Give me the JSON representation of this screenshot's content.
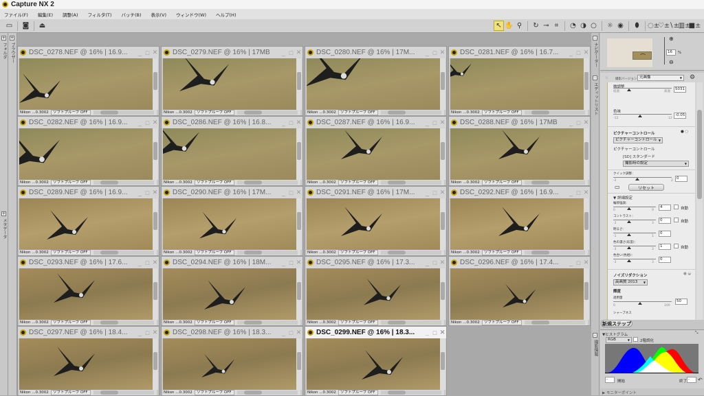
{
  "app": {
    "title": "Capture NX 2"
  },
  "menu": [
    "ファイル(F)",
    "編集(E)",
    "調整(A)",
    "フィルタ(T)",
    "バッチ(B)",
    "表示(V)",
    "ウィンドウ(W)",
    "ヘルプ(H)"
  ],
  "left_tabs": {
    "folder": "フォルダ",
    "browser": "ブラウザー",
    "metadata": "メタデータ"
  },
  "tiles": [
    {
      "title": "DSC_0278.NEF @ 16% | 16.9..."
    },
    {
      "title": "DSC_0279.NEF @ 16% | 17MB"
    },
    {
      "title": "DSC_0280.NEF @ 16% | 17M..."
    },
    {
      "title": "DSC_0281.NEF @ 16% | 16.7..."
    },
    {
      "title": "DSC_0282.NEF @ 16% | 16.9..."
    },
    {
      "title": "DSC_0286.NEF @ 16% | 16.8..."
    },
    {
      "title": "DSC_0287.NEF @ 16% | 16.9..."
    },
    {
      "title": "DSC_0288.NEF @ 16% | 17MB"
    },
    {
      "title": "DSC_0289.NEF @ 16% | 16.9..."
    },
    {
      "title": "DSC_0290.NEF @ 16% | 17M..."
    },
    {
      "title": "DSC_0291.NEF @ 16% | 17M..."
    },
    {
      "title": "DSC_0292.NEF @ 16% | 16.9..."
    },
    {
      "title": "DSC_0293.NEF @ 16% | 17.6..."
    },
    {
      "title": "DSC_0294.NEF @ 16% | 18M..."
    },
    {
      "title": "DSC_0295.NEF @ 16% | 17.3..."
    },
    {
      "title": "DSC_0296.NEF @ 16% | 17.4..."
    },
    {
      "title": "DSC_0297.NEF @ 16% | 18.4..."
    },
    {
      "title": "DSC_0298.NEF @ 16% | 18.3..."
    },
    {
      "title": "DSC_0299.NEF @ 16% | 18.3...",
      "active": true
    }
  ],
  "tile_status": {
    "camera": "Nikon ...0.3002",
    "softproof": "ソフトプルーフ OFF"
  },
  "right": {
    "tabs": {
      "navigator": "ナビゲーター",
      "editlist": "エディットリスト",
      "info": "撮影情報"
    },
    "navigator": {
      "zoom": "16",
      "unit": "%"
    },
    "version_label": "撮影バージョン",
    "version": "元画像",
    "fine": {
      "label": "微調整",
      "low": "低温",
      "high": "高温",
      "value": "5031"
    },
    "tint": {
      "label": "色味",
      "min": "-12",
      "max": "12",
      "value": "-0.05"
    },
    "pc": {
      "header": "ピクチャーコントロール",
      "dropdown": "ピクチャーコントロール",
      "label": "ピクチャーコントロール",
      "preset": "[SD] スタンダード",
      "setting": "撮影時の設定"
    },
    "quick": {
      "label": "クイック調整：",
      "min": "-2",
      "max": "2",
      "value": "0",
      "reset": "リセット"
    },
    "detail": "▼ 詳細設定",
    "auto": "自動",
    "sliders": [
      {
        "label": "輪郭強調：",
        "min": "0",
        "max": "9",
        "value": "4",
        "auto": true
      },
      {
        "label": "コントラスト：",
        "min": "-3",
        "max": "3",
        "value": "0",
        "auto": true
      },
      {
        "label": "明るさ：",
        "min": "-1",
        "max": "1",
        "value": "0",
        "auto": false
      },
      {
        "label": "色の濃さ(彩度)：",
        "min": "-3",
        "max": "3",
        "value": "1",
        "auto": true
      },
      {
        "label": "色合い(色相)：",
        "min": "-3",
        "max": "3",
        "value": "0",
        "auto": false
      }
    ],
    "nr": {
      "header": "ノイズリダクション",
      "mode": "高画質 2013",
      "lum": "輝度",
      "amount": "適用量",
      "min": "0",
      "max": "100",
      "value": "50",
      "sharp": "シャープネス"
    },
    "new_step": "新規ステップ",
    "histogram": {
      "header": "▼ヒストグラム",
      "channel": "RGB",
      "binarize": "2階調化",
      "start": "開始",
      "end": "終了",
      "start_value": "-",
      "end_value": "-"
    },
    "monitor": "▶ モニターポイント"
  }
}
